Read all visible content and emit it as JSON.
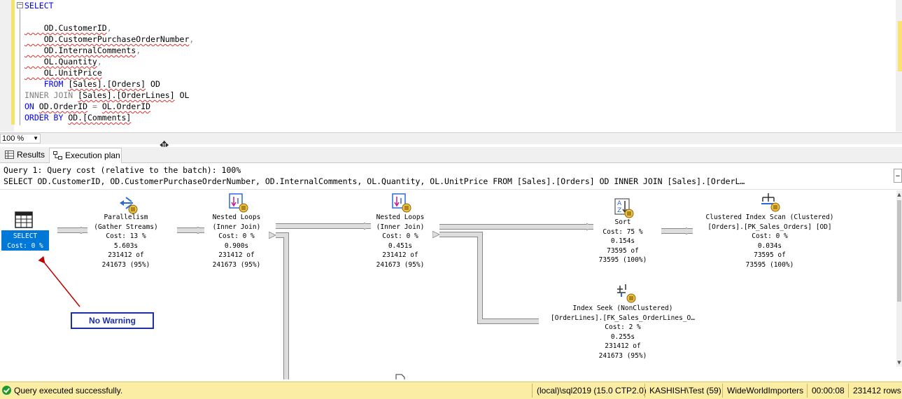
{
  "editor": {
    "lines": [
      {
        "tokens": [
          {
            "t": "SELECT",
            "c": "kw"
          }
        ]
      },
      {
        "tokens": []
      },
      {
        "tokens": [
          {
            "t": "    OD.CustomerID",
            "c": "id"
          },
          {
            "t": ",",
            "c": "gray"
          }
        ]
      },
      {
        "tokens": [
          {
            "t": "    OD.CustomerPurchaseOrderNumber",
            "c": "id"
          },
          {
            "t": ",",
            "c": "gray"
          }
        ]
      },
      {
        "tokens": [
          {
            "t": "    OD.InternalComments",
            "c": "id"
          },
          {
            "t": ",",
            "c": "gray"
          }
        ]
      },
      {
        "tokens": [
          {
            "t": "    OL.Quantity",
            "c": "id"
          },
          {
            "t": ",",
            "c": "gray"
          }
        ]
      },
      {
        "tokens": [
          {
            "t": "    OL.UnitPrice",
            "c": "id"
          }
        ]
      },
      {
        "tokens": [
          {
            "t": "    FROM ",
            "c": "kw"
          },
          {
            "t": "[Sales].[Orders]",
            "c": "id"
          },
          {
            "t": " OD",
            "c": "plain"
          }
        ]
      },
      {
        "tokens": [
          {
            "t": "INNER JOIN ",
            "c": "gray"
          },
          {
            "t": "[Sales].[OrderLines]",
            "c": "id"
          },
          {
            "t": " OL",
            "c": "plain"
          }
        ]
      },
      {
        "tokens": [
          {
            "t": "ON ",
            "c": "kw"
          },
          {
            "t": "OD.OrderID",
            "c": "id"
          },
          {
            "t": " = ",
            "c": "gray"
          },
          {
            "t": "OL.OrderID",
            "c": "id"
          }
        ]
      },
      {
        "tokens": [
          {
            "t": "ORDER BY ",
            "c": "kw"
          },
          {
            "t": "OD.[Comments]",
            "c": "id"
          }
        ]
      }
    ],
    "zoom": "100 %"
  },
  "tabs": {
    "results": "Results",
    "plan": "Execution plan"
  },
  "plan": {
    "header_line1": "Query 1: Query cost (relative to the batch): 100%",
    "header_line2": "SELECT OD.CustomerID, OD.CustomerPurchaseOrderNumber, OD.InternalComments, OL.Quantity, OL.UnitPrice FROM [Sales].[Orders] OD INNER JOIN [Sales].[OrderL…",
    "header_more": "…",
    "select_op": {
      "title": "SELECT",
      "cost": "Cost: 0 %"
    },
    "operators": [
      {
        "key": "parallelism",
        "icon": "parallelism-icon",
        "lines": [
          "Parallelism",
          "(Gather Streams)",
          "Cost: 13 %",
          "5.603s",
          "231412 of",
          "241673 (95%)"
        ]
      },
      {
        "key": "nested-loops-1",
        "icon": "nested-loops-icon",
        "lines": [
          "Nested Loops",
          "(Inner Join)",
          "Cost: 0 %",
          "0.900s",
          "231412 of",
          "241673 (95%)"
        ]
      },
      {
        "key": "nested-loops-2",
        "icon": "nested-loops-icon",
        "lines": [
          "Nested Loops",
          "(Inner Join)",
          "Cost: 0 %",
          "0.451s",
          "231412 of",
          "241673 (95%)"
        ]
      },
      {
        "key": "sort",
        "icon": "sort-icon",
        "lines": [
          "Sort",
          "Cost: 75 %",
          "0.154s",
          "73595 of",
          "73595 (100%)"
        ]
      },
      {
        "key": "clustered-index-scan",
        "icon": "clustered-index-scan-icon",
        "lines": [
          "Clustered Index Scan (Clustered)",
          "[Orders].[PK_Sales_Orders] [OD]",
          "Cost: 0 %",
          "0.034s",
          "73595 of",
          "73595 (100%)"
        ]
      },
      {
        "key": "index-seek",
        "icon": "index-seek-icon",
        "lines": [
          "Index Seek (NonClustered)",
          "[OrderLines].[FK_Sales_OrderLines_O…",
          "Cost: 2 %",
          "0.255s",
          "231412 of",
          "241673 (95%)"
        ]
      }
    ],
    "annotation": "No Warning"
  },
  "status": {
    "message": "Query executed successfully.",
    "server": "(local)\\sql2019 (15.0 CTP2.0)",
    "user": "KASHISH\\Test (59)",
    "database": "WideWorldImporters",
    "elapsed": "00:00:08",
    "rows": "231412 rows"
  },
  "colors": {
    "accent": "#0078d7",
    "status_bar": "#fbeda4",
    "annotation": "#1c2ea8",
    "arrow": "#c00000"
  }
}
